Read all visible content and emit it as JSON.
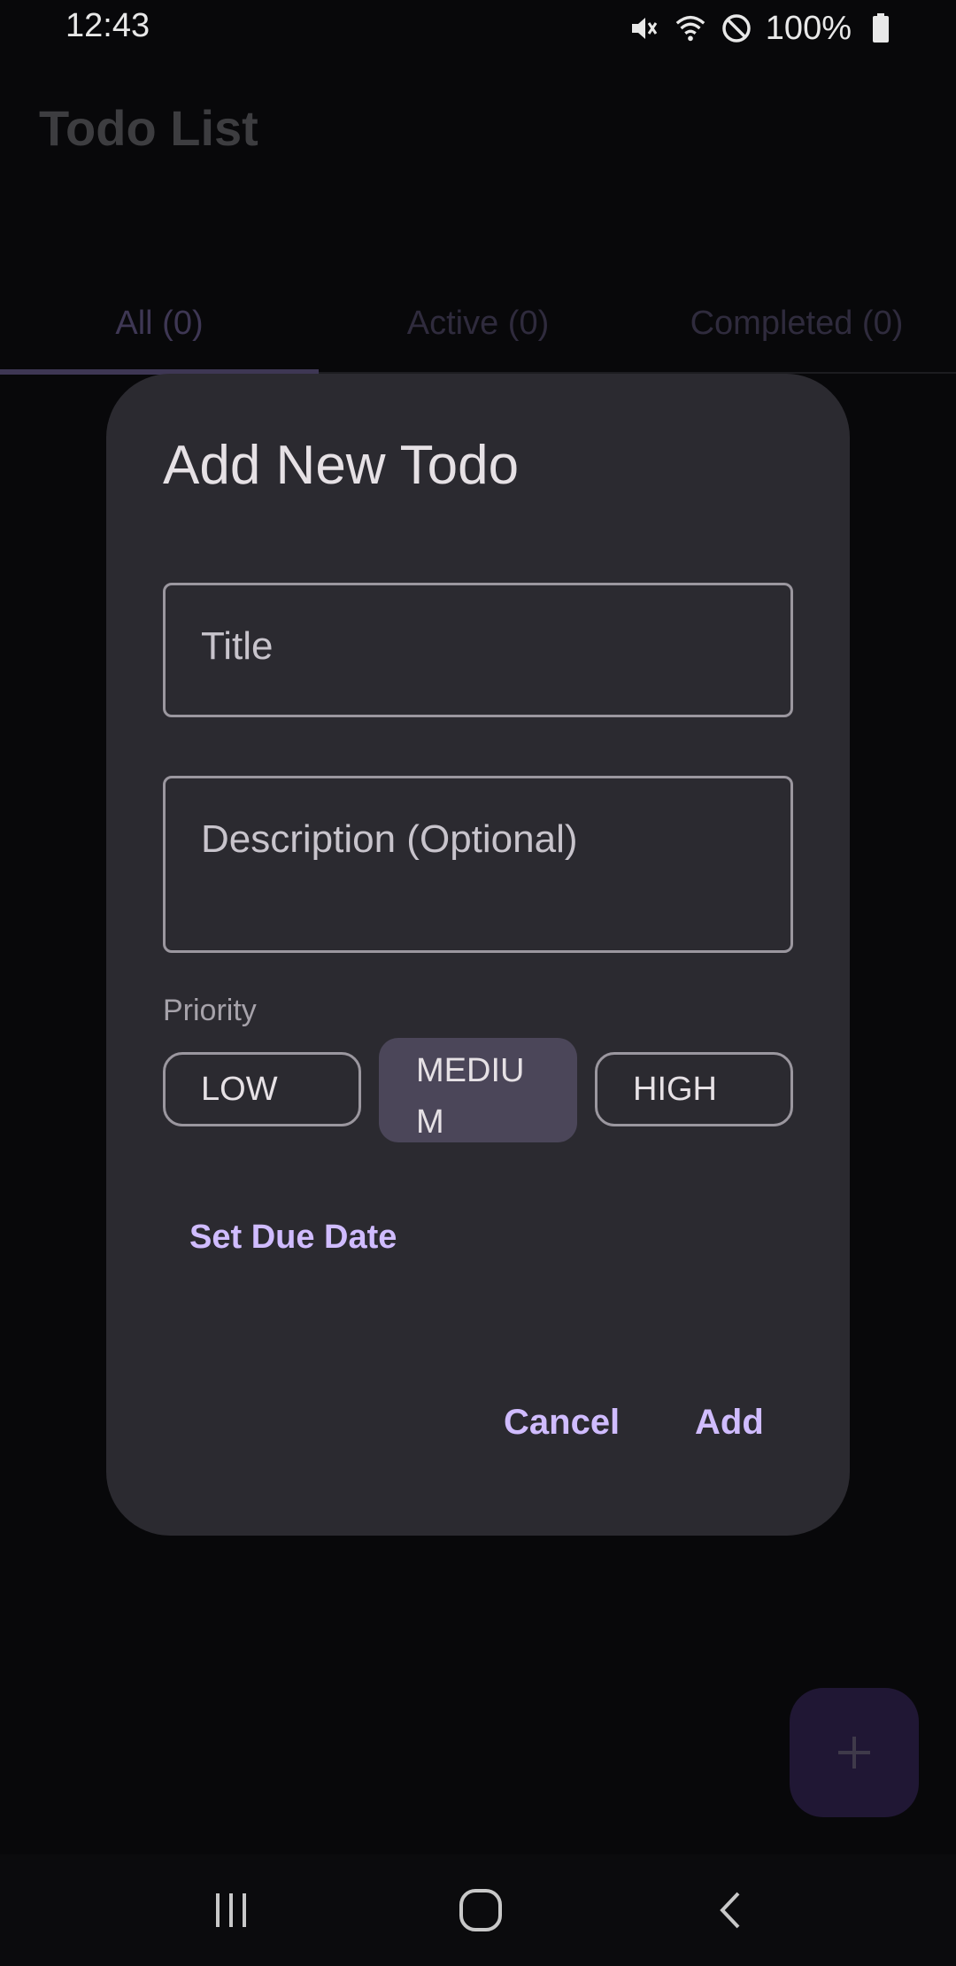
{
  "status_bar": {
    "time": "12:43",
    "battery_percent": "100%",
    "icons": [
      "mute-icon",
      "wifi-icon",
      "do-not-disturb-icon",
      "battery-icon"
    ]
  },
  "app_bar": {
    "title": "Todo List"
  },
  "tabs": [
    {
      "label": "All (0)",
      "selected": true
    },
    {
      "label": "Active (0)",
      "selected": false
    },
    {
      "label": "Completed (0)",
      "selected": false
    }
  ],
  "dialog": {
    "title": "Add New Todo",
    "title_field": {
      "placeholder": "Title",
      "value": ""
    },
    "description_field": {
      "placeholder": "Description (Optional)",
      "value": ""
    },
    "priority_label": "Priority",
    "priority_options": [
      {
        "label": "LOW",
        "selected": false
      },
      {
        "label": "MEDIUM",
        "selected": true
      },
      {
        "label": "HIGH",
        "selected": false
      }
    ],
    "set_due_date_label": "Set Due Date",
    "cancel_label": "Cancel",
    "add_label": "Add"
  },
  "fab": {
    "icon": "plus-icon"
  },
  "nav_bar": {
    "icons": [
      "recent-apps-icon",
      "home-icon",
      "back-icon"
    ]
  },
  "colors": {
    "background": "#08080a",
    "dialog_surface": "#2b2a30",
    "accent": "#d0bcff",
    "selected_chip": "#4b4659",
    "outline": "#9b979f"
  }
}
